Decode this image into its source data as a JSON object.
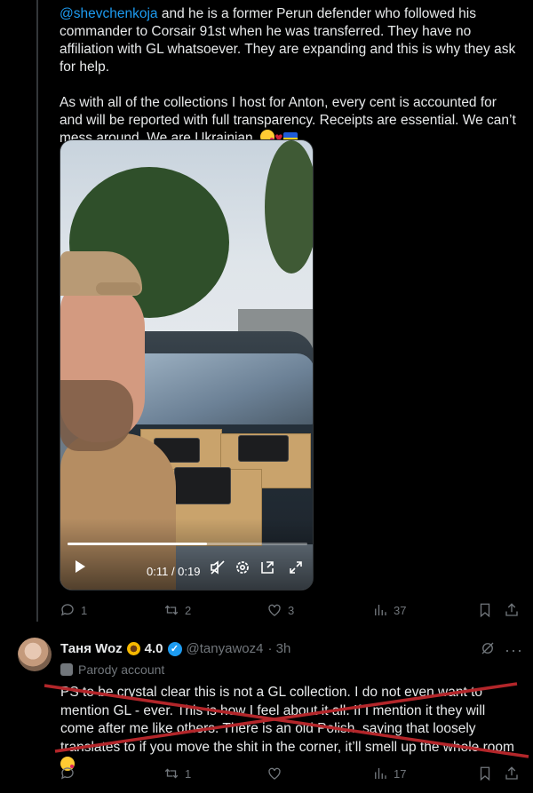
{
  "tweet": {
    "mention": "@shevchenkoja",
    "text_after_mention": " and he is a former Perun defender who followed his commander to Corsair 91st when he was transferred. They have no affiliation with GL whatsoever. They are expanding and this is why they ask for help.",
    "paragraph2": "As with all of the collections I host for Anton, every cent is accounted for and will be reported with full transparency. Receipts are essential. We can’t mess around. We are Ukrainian. ",
    "video": {
      "time": "0:11 / 0:19",
      "progress": 0.58,
      "controls": [
        "play-icon",
        "mute-icon",
        "settings-icon",
        "pip-icon",
        "fullscreen-icon"
      ]
    },
    "actions": {
      "replies": "1",
      "reposts": "2",
      "likes": "3",
      "views": "37"
    }
  },
  "reply": {
    "name": "Таня Woz",
    "score": "4.0",
    "handle": "@tanyawoz4",
    "time": "· 3h",
    "badge": "Parody account",
    "text": "PS to be crystal clear this is not a GL collection. I do not even want to mention GL - ever. This is how I feel about it all. If I mention it they will come after me like others. There is an old Polish  saying that loosely translates to if you move the shit in the corner, it’ll smell up the whole room ",
    "actions": {
      "replies": "",
      "reposts": "1",
      "likes": "",
      "views": "17"
    }
  },
  "colors": {
    "accent": "#1d9bf0",
    "background": "#000000",
    "muted": "#71767b",
    "strike": "#b3262a"
  }
}
